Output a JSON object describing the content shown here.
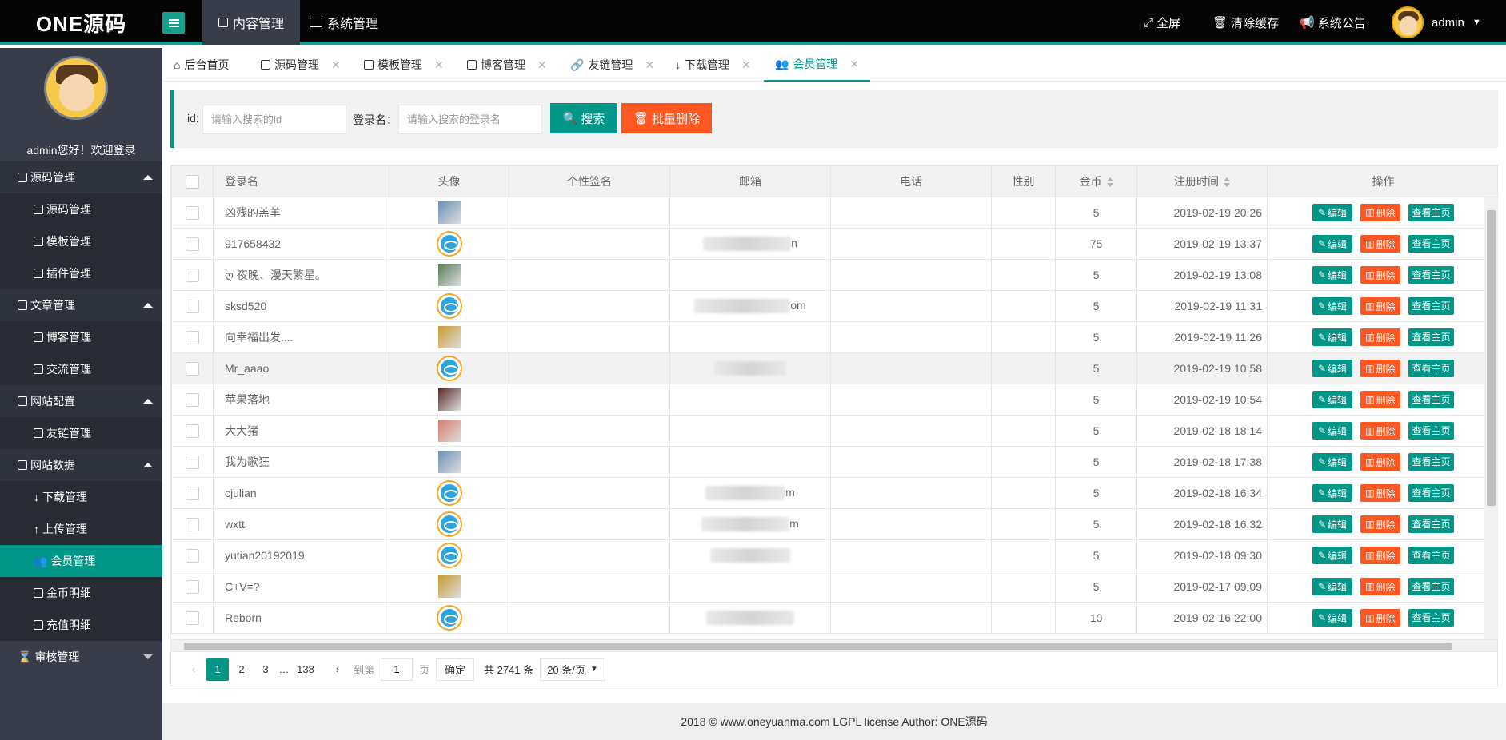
{
  "brand": "ONE源码",
  "topnav": [
    {
      "label": "内容管理",
      "icon": "word-doc-icon",
      "active": true
    },
    {
      "label": "系统管理",
      "icon": "monitor-icon",
      "active": false
    }
  ],
  "topright": {
    "fullscreen": "全屏",
    "clear_cache": "清除缓存",
    "announcement": "系统公告",
    "user": "admin"
  },
  "sidebar": {
    "welcome": "admin您好！欢迎登录",
    "groups": [
      {
        "label": "源码管理",
        "items": [
          "源码管理",
          "模板管理",
          "插件管理"
        ]
      },
      {
        "label": "文章管理",
        "items": [
          "博客管理",
          "交流管理"
        ]
      },
      {
        "label": "网站配置",
        "items": [
          "友链管理"
        ]
      },
      {
        "label": "网站数据",
        "items": [
          "下载管理",
          "上传管理",
          "会员管理",
          "金币明细",
          "充值明细"
        ]
      },
      {
        "label": "审核管理",
        "items": []
      }
    ]
  },
  "tabs": [
    "后台首页",
    "源码管理",
    "模板管理",
    "博客管理",
    "友链管理",
    "下载管理",
    "会员管理"
  ],
  "search": {
    "id_label": "id:",
    "id_placeholder": "请输入搜索的id",
    "login_label": "登录名：",
    "login_placeholder": "请输入搜索的登录名",
    "search_btn": "搜索",
    "batch_delete_btn": "批量删除"
  },
  "table": {
    "headers": [
      "登录名",
      "头像",
      "个性签名",
      "邮箱",
      "电话",
      "性别",
      "金币",
      "注册时间",
      "操作"
    ],
    "rows": [
      {
        "name": "凶残的羔羊",
        "avatar": "photo",
        "email_tail": "",
        "coins": "5",
        "time": "2019-02-19 20:26"
      },
      {
        "name": "917658432",
        "avatar": "default",
        "email_tail": "n",
        "coins": "75",
        "time": "2019-02-19 13:37"
      },
      {
        "name": "ღ 夜晚、漫天繁星。",
        "avatar": "photo",
        "email_tail": "",
        "coins": "5",
        "time": "2019-02-19 13:08"
      },
      {
        "name": "sksd520",
        "avatar": "default",
        "email_tail": "om",
        "coins": "5",
        "time": "2019-02-19 11:31"
      },
      {
        "name": "向幸福出发....",
        "avatar": "photo",
        "email_tail": "",
        "coins": "5",
        "time": "2019-02-19 11:26"
      },
      {
        "name": "Mr_aaao",
        "avatar": "default",
        "email_tail": "",
        "coins": "5",
        "time": "2019-02-19 10:58"
      },
      {
        "name": "苹果落地",
        "avatar": "photo",
        "email_tail": "",
        "coins": "5",
        "time": "2019-02-19 10:54"
      },
      {
        "name": "大大猪",
        "avatar": "photo",
        "email_tail": "",
        "coins": "5",
        "time": "2019-02-18 18:14"
      },
      {
        "name": "我为歌狂",
        "avatar": "photo",
        "email_tail": "",
        "coins": "5",
        "time": "2019-02-18 17:38"
      },
      {
        "name": "cjulian",
        "avatar": "default",
        "email_tail": "m",
        "coins": "5",
        "time": "2019-02-18 16:34"
      },
      {
        "name": "wxtt",
        "avatar": "default",
        "email_tail": "m",
        "coins": "5",
        "time": "2019-02-18 16:32"
      },
      {
        "name": "yutian20192019",
        "avatar": "default",
        "email_tail": "",
        "coins": "5",
        "time": "2019-02-18 09:30"
      },
      {
        "name": "C+V=?",
        "avatar": "photo",
        "email_tail": "",
        "coins": "5",
        "time": "2019-02-17 09:09"
      },
      {
        "name": "Reborn",
        "avatar": "default",
        "email_tail": "",
        "coins": "10",
        "time": "2019-02-16 22:00"
      }
    ],
    "ops": {
      "edit": "编辑",
      "delete": "删除",
      "home": "查看主页"
    }
  },
  "pager": {
    "pages": [
      "1",
      "2",
      "3",
      "…",
      "138"
    ],
    "goto_label": "到第",
    "goto_value": "1",
    "page_unit": "页",
    "confirm": "确定",
    "total": "共 2741 条",
    "page_size": "20 条/页"
  },
  "footer": "2018 © www.oneyuanma.com LGPL license Author: ONE源码",
  "colors": {
    "accent": "#009688",
    "danger": "#ff5722",
    "sidebar": "#393d49",
    "header": "#050505"
  }
}
